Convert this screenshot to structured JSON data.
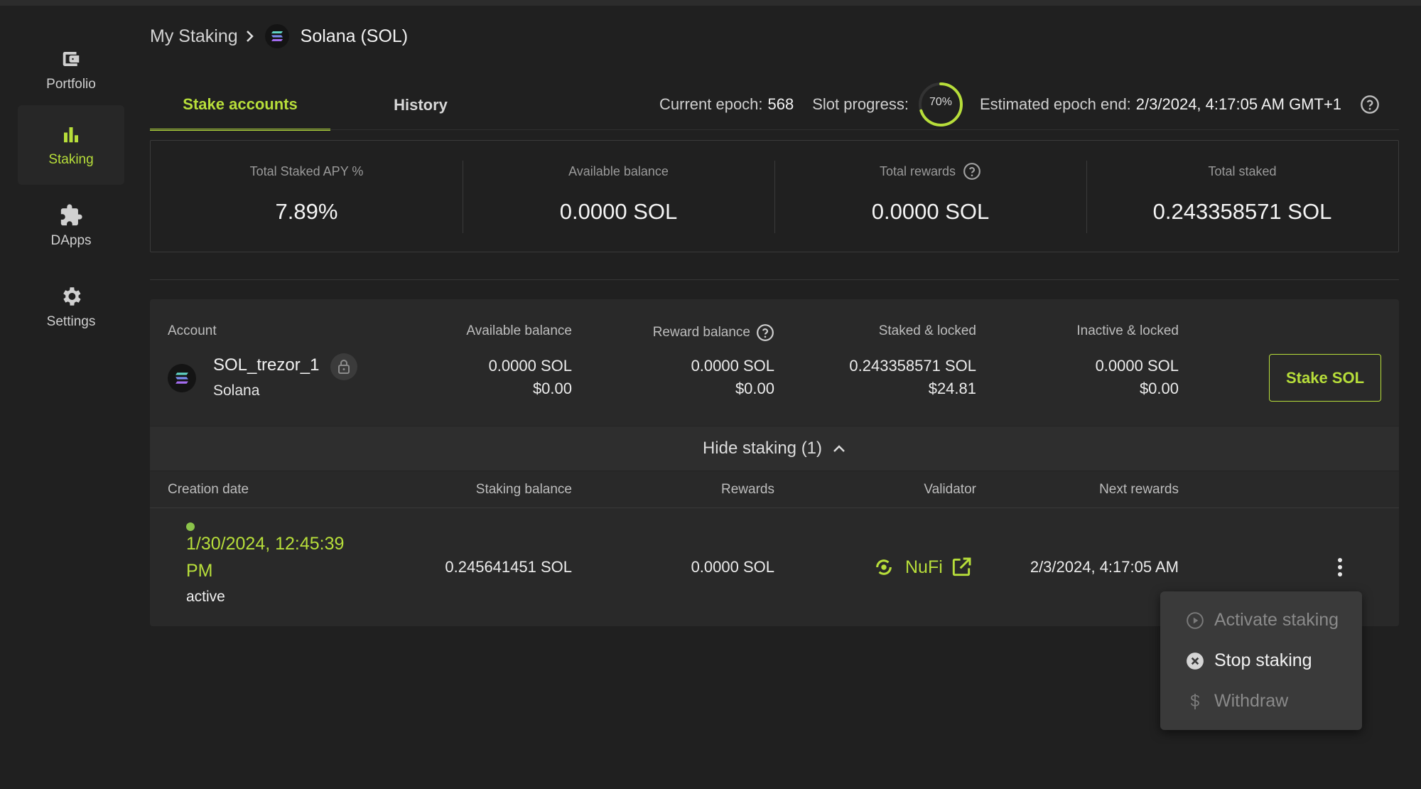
{
  "sidebar": {
    "items": [
      {
        "label": "Portfolio",
        "icon": "wallet-icon"
      },
      {
        "label": "Staking",
        "icon": "bar-chart-icon"
      },
      {
        "label": "DApps",
        "icon": "puzzle-icon"
      },
      {
        "label": "Settings",
        "icon": "gear-icon"
      }
    ],
    "active_index": 1
  },
  "breadcrumb": {
    "parent": "My Staking",
    "current": "Solana (SOL)"
  },
  "tabs": [
    {
      "label": "Stake accounts",
      "active": true
    },
    {
      "label": "History",
      "active": false
    }
  ],
  "epoch": {
    "current_label": "Current epoch:",
    "current_value": "568",
    "slot_label": "Slot progress:",
    "slot_percent_text": "70%",
    "slot_progress": 0.7,
    "end_label": "Estimated epoch end:",
    "end_value": "2/3/2024, 4:17:05 AM GMT+1"
  },
  "summary": {
    "apy_label": "Total Staked APY %",
    "apy_value": "7.89%",
    "available_label": "Available balance",
    "available_value": "0.0000 SOL",
    "rewards_label": "Total rewards",
    "rewards_value": "0.0000 SOL",
    "staked_label": "Total staked",
    "staked_value": "0.243358571 SOL"
  },
  "account_table": {
    "headers": {
      "account": "Account",
      "available": "Available balance",
      "reward": "Reward balance",
      "staked": "Staked & locked",
      "inactive": "Inactive & locked"
    },
    "row": {
      "name": "SOL_trezor_1",
      "network": "Solana",
      "available_sol": "0.0000 SOL",
      "available_usd": "$0.00",
      "reward_sol": "0.0000 SOL",
      "reward_usd": "$0.00",
      "staked_sol": "0.243358571 SOL",
      "staked_usd": "$24.81",
      "inactive_sol": "0.0000 SOL",
      "inactive_usd": "$0.00"
    },
    "stake_button": "Stake SOL",
    "hide_staking": "Hide staking (1)"
  },
  "staking_table": {
    "headers": {
      "creation": "Creation date",
      "balance": "Staking balance",
      "rewards": "Rewards",
      "validator": "Validator",
      "next": "Next rewards"
    },
    "row": {
      "date": "1/30/2024, 12:45:39 PM",
      "status": "active",
      "balance": "0.245641451 SOL",
      "rewards": "0.0000 SOL",
      "validator": "NuFi",
      "next": "2/3/2024, 4:17:05 AM"
    }
  },
  "menu": {
    "items": [
      {
        "label": "Activate staking",
        "icon": "play-circle-icon",
        "enabled": false
      },
      {
        "label": "Stop staking",
        "icon": "cancel-circle-icon",
        "enabled": true
      },
      {
        "label": "Withdraw",
        "icon": "dollar-icon",
        "enabled": false
      }
    ]
  },
  "colors": {
    "accent": "#b7de3a",
    "background": "#202020",
    "panel": "#292929",
    "menu": "#3a3a3a"
  }
}
